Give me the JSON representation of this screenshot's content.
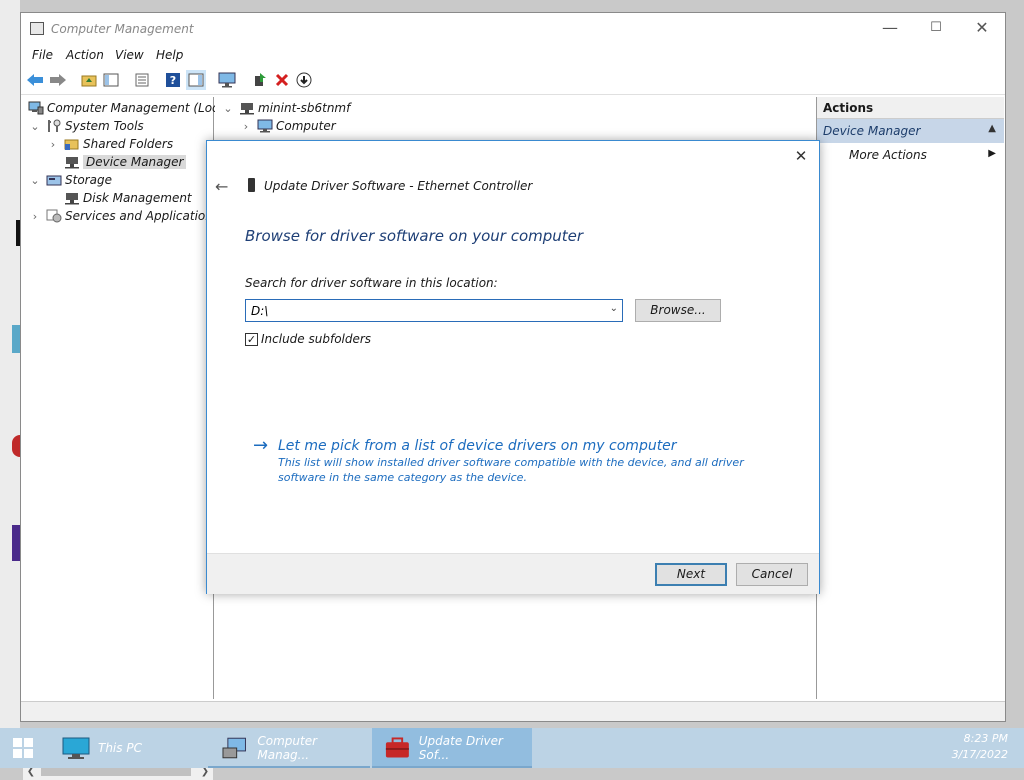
{
  "window": {
    "title": "Computer Management"
  },
  "menu": [
    "File",
    "Action",
    "View",
    "Help"
  ],
  "toolbar": {
    "icons": [
      "back-arrow-icon",
      "forward-arrow-icon",
      "up-folder-icon",
      "show-hide-tree-icon",
      "properties-icon",
      "help-icon",
      "show-hide-action-pane-icon",
      "monitor-icon",
      "update-driver-icon",
      "uninstall-icon",
      "enable-device-icon"
    ]
  },
  "tree": {
    "items": [
      {
        "label": "Computer Management (Local)",
        "level": 0,
        "expanded": true
      },
      {
        "label": "System Tools",
        "level": 1,
        "expanded": true
      },
      {
        "label": "Shared Folders",
        "level": 2,
        "expanded": false
      },
      {
        "label": "Device Manager",
        "level": 2,
        "selected": true
      },
      {
        "label": "Storage",
        "level": 1,
        "expanded": true
      },
      {
        "label": "Disk Management",
        "level": 2
      },
      {
        "label": "Services and Applications",
        "level": 1,
        "expanded": false
      }
    ]
  },
  "device_tree": {
    "root": "minint-sb6tnmf",
    "children": [
      "Computer"
    ]
  },
  "actions": {
    "header": "Actions",
    "section": "Device Manager",
    "more": "More Actions"
  },
  "dialog": {
    "title": "Update Driver Software - Ethernet Controller",
    "heading": "Browse for driver software on your computer",
    "search_label": "Search for driver software in this location:",
    "path_value": "D:\\",
    "browse_label": "Browse...",
    "include_subfolders_label": "Include subfolders",
    "include_subfolders_checked": true,
    "pick_link": "Let me pick from a list of device drivers on my computer",
    "pick_desc": "This list will show installed driver software compatible with the device, and all driver software in the same category as the device.",
    "next_label": "Next",
    "cancel_label": "Cancel"
  },
  "taskbar": {
    "items": [
      {
        "label": "This PC",
        "active": false
      },
      {
        "label": "Computer Manag...",
        "active": false
      },
      {
        "label": "Update Driver Sof...",
        "active": true
      }
    ],
    "time": "8:23 PM",
    "date": "3/17/2022"
  },
  "colors": {
    "accent": "#1c6cbf",
    "heading": "#1e3f76",
    "taskbar": "#bcd3e5",
    "selection": "#c7d6e8"
  }
}
